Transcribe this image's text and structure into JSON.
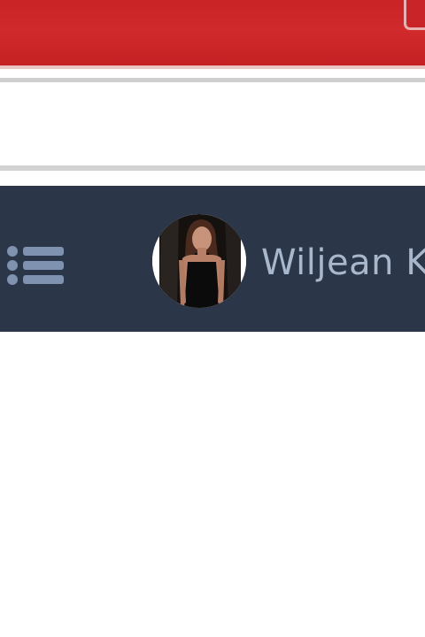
{
  "header": {
    "user_name": "Wiljean K",
    "avatar_icon": "user-avatar-photo",
    "menu_icon": "list-menu-icon"
  },
  "colors": {
    "titlebar": "#c92326",
    "navbar": "#2b3648",
    "menu_icon": "#7f93b0",
    "user_name": "#a8b7cc"
  }
}
